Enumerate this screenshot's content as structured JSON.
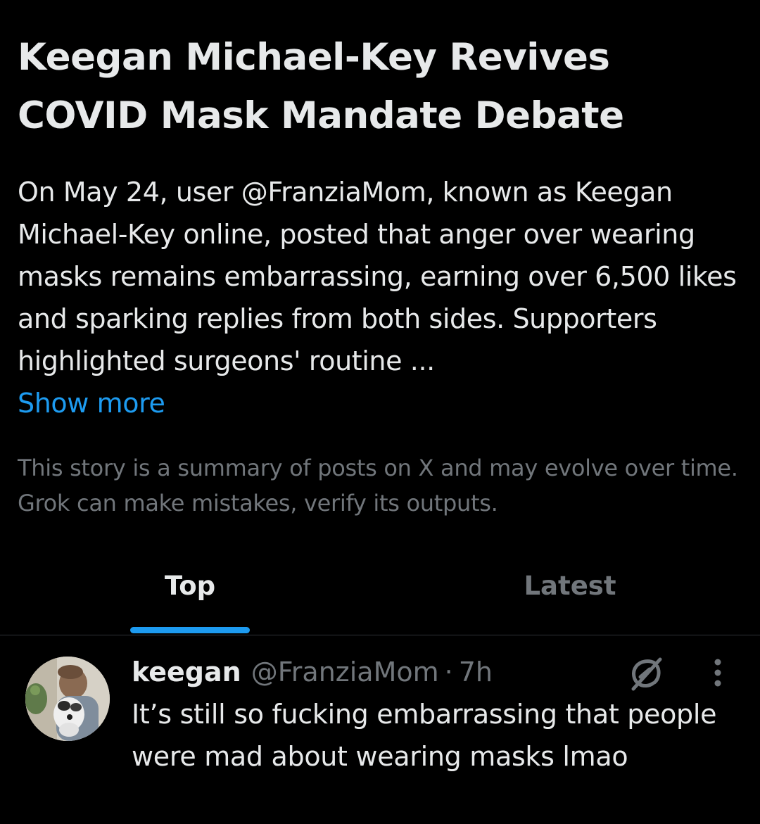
{
  "story": {
    "title": "Keegan Michael-Key Revives COVID Mask Mandate Debate",
    "summary": "On May 24, user @FranziaMom, known as Keegan Michael-Key online, posted that anger over wearing masks remains embarrassing, earning over 6,500 likes and sparking replies from both sides. Supporters highlighted surgeons' routine ...",
    "show_more_label": "Show more",
    "disclaimer": "This story is a summary of posts on X and may evolve over time. Grok can make mistakes, verify its outputs."
  },
  "tabs": [
    {
      "label": "Top",
      "active": true
    },
    {
      "label": "Latest",
      "active": false
    }
  ],
  "post": {
    "display_name": "keegan",
    "handle": "@FranziaMom",
    "separator": "·",
    "time": "7h",
    "text": "It’s still so fucking embarrassing that people were mad about wearing masks lmao",
    "icons": {
      "grok": "grok-icon",
      "more": "more-vertical-icon"
    }
  },
  "colors": {
    "background": "#000000",
    "text_primary": "#e7e9ea",
    "text_secondary": "#71767b",
    "accent": "#1d9bf0",
    "divider": "#2f3336"
  }
}
